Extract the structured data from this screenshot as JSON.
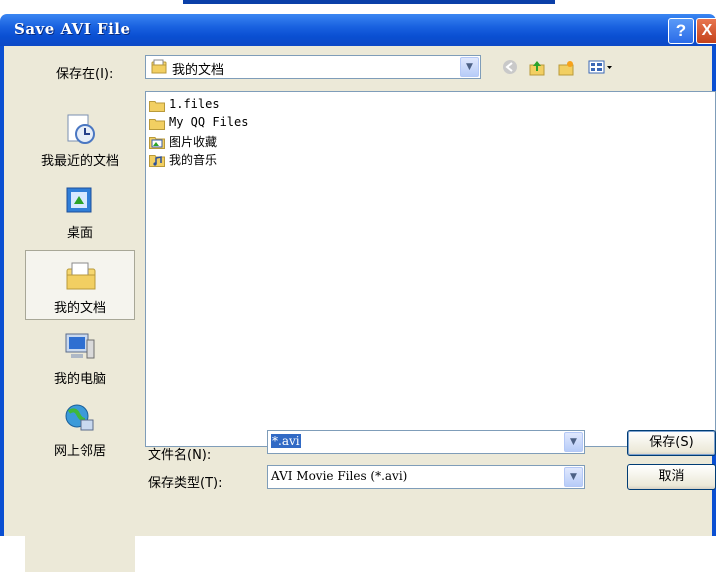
{
  "window": {
    "title": "Save AVI File",
    "help_glyph": "?",
    "close_glyph": "X"
  },
  "save_in": {
    "label": "保存在(I):",
    "value": "我的文档"
  },
  "toolbar": {
    "icons": [
      "back-icon",
      "up-folder-icon",
      "new-folder-icon",
      "view-menu-icon"
    ]
  },
  "places": [
    {
      "label": "我最近的文档",
      "icon": "recent-documents-icon"
    },
    {
      "label": "桌面",
      "icon": "desktop-icon"
    },
    {
      "label": "我的文档",
      "icon": "my-documents-icon"
    },
    {
      "label": "我的电脑",
      "icon": "my-computer-icon"
    },
    {
      "label": "网上邻居",
      "icon": "network-places-icon"
    }
  ],
  "files": [
    {
      "name": "1.files",
      "icon": "folder-icon"
    },
    {
      "name": "My QQ Files",
      "icon": "folder-icon"
    },
    {
      "name": "图片收藏",
      "icon": "pictures-folder-icon"
    },
    {
      "name": "我的音乐",
      "icon": "music-folder-icon"
    }
  ],
  "file_name": {
    "label": "文件名(N):",
    "value": "*.avi"
  },
  "file_type": {
    "label": "保存类型(T):",
    "value": "AVI Movie Files (*.avi)"
  },
  "buttons": {
    "save": "保存(S)",
    "cancel": "取消"
  },
  "colors": {
    "title_bar": "#0a4fd2",
    "dialog_bg": "#ece9d8",
    "selection": "#316ac5"
  }
}
